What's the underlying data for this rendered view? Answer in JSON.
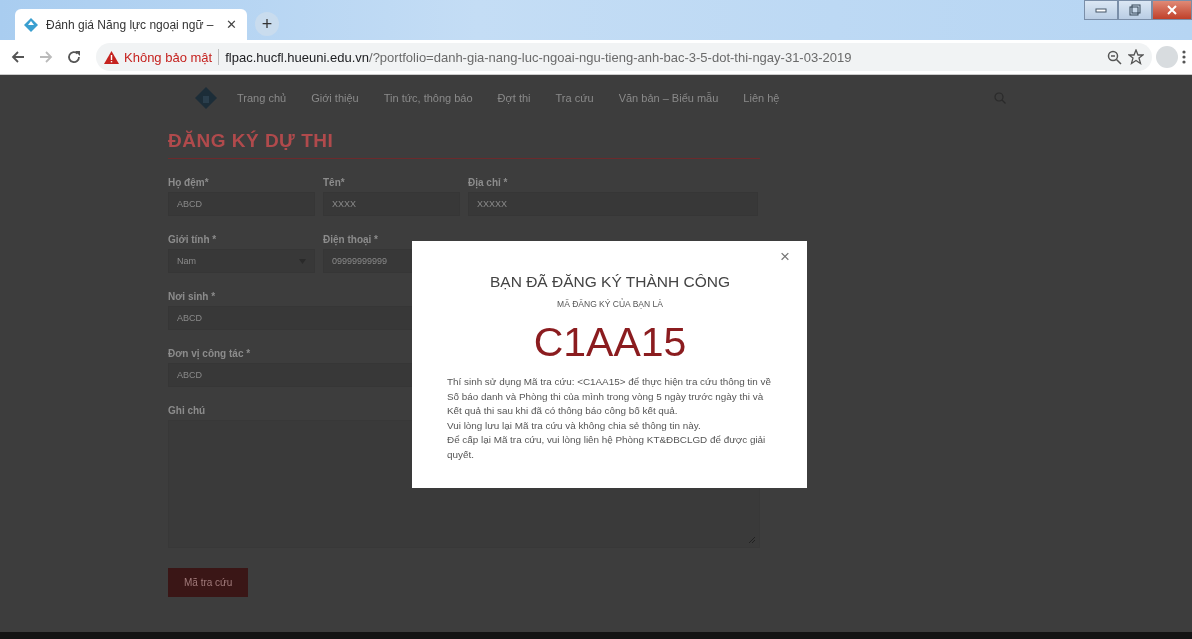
{
  "browser": {
    "tab": {
      "title": "Đánh giá Năng lực ngoại ngữ –",
      "selected": true
    },
    "tab_close": "✕",
    "new_tab": "+",
    "forward_disabled": true,
    "security": "Không bảo mật",
    "url_host": "flpac.hucfl.hueuni.edu.vn",
    "url_path": "/?portfolio=danh-gia-nang-luc-ngoai-ngu-tieng-anh-bac-3-5-dot-thi-ngay-31-03-2019"
  },
  "nav": {
    "items": [
      {
        "label": "Trang chủ"
      },
      {
        "label": "Giới thiệu"
      },
      {
        "label": "Tin tức, thông báo"
      },
      {
        "label": "Đợt thi"
      },
      {
        "label": "Tra cứu"
      },
      {
        "label": "Văn bản – Biểu mẫu"
      },
      {
        "label": "Liên hệ"
      }
    ]
  },
  "form": {
    "title": "ĐĂNG KÝ DỰ THI",
    "rows": [
      [
        {
          "kind": "input",
          "label": "Họ đệm*",
          "value": "ABCD"
        },
        {
          "kind": "input",
          "label": "Tên*",
          "value": "XXXX"
        },
        {
          "kind": "input",
          "label": "Địa chỉ *",
          "value": "XXXXX"
        }
      ],
      [
        {
          "kind": "select",
          "label": "Giới tính *",
          "value": "Nam"
        },
        {
          "kind": "input",
          "label": "Điện thoại *",
          "value": "09999999999"
        }
      ],
      [
        {
          "kind": "input",
          "label": "Nơi sinh *",
          "value": "ABCD"
        }
      ],
      [
        {
          "kind": "input",
          "label": "Đơn vị công tác *",
          "value": "ABCD"
        }
      ],
      [
        {
          "kind": "textarea",
          "label": "Ghi chú"
        }
      ]
    ],
    "submit": "Mã tra cứu"
  },
  "modal": {
    "close": "×",
    "title": "BẠN ĐÃ ĐĂNG KÝ THÀNH CÔNG",
    "subtitle": "MÃ ĐĂNG KÝ CỦA BẠN LÀ",
    "code": "C1AA15",
    "paragraphs": [
      "Thí sinh sử dụng Mã tra cứu: <C1AA15> để thực hiện tra cứu thông tin về Số báo danh và Phòng thi của mình trong vòng 5 ngày trước ngày thi và Kết quả thi sau khi đã có thông báo công bố kết quả.",
      "Vui lòng lưu lại Mã tra cứu và không chia sẻ thông tin này.",
      "Để cấp lại Mã tra cứu, vui lòng liên hệ Phòng KT&ĐBCLGD để được giải quyết."
    ]
  }
}
